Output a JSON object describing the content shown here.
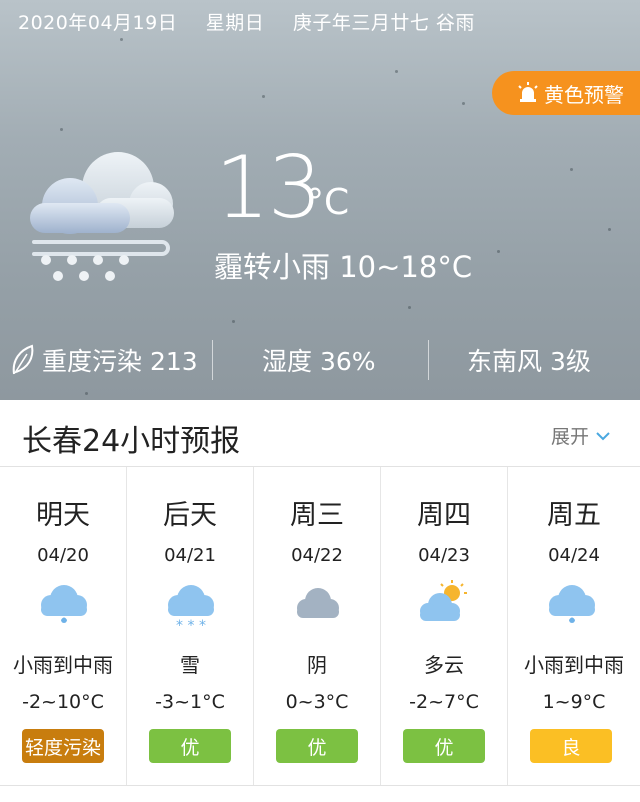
{
  "header": {
    "date": "2020年04月19日",
    "weekday": "星期日",
    "lunar": "庚子年三月廿七 谷雨"
  },
  "alert": {
    "label": "黄色预警",
    "icon": "alarm-light-icon",
    "color": "#f6921e"
  },
  "current": {
    "icon": "cloud-snow-icon",
    "temperature": "13",
    "unit": "°C",
    "condition": "霾转小雨 10~18°C"
  },
  "stats": {
    "air": "重度污染 213",
    "air_icon": "leaf-icon",
    "humidity": "湿度 36%",
    "wind": "东南风 3级"
  },
  "forecast": {
    "title": "长春24小时预报",
    "expand_label": "展开",
    "days": [
      {
        "name": "明天",
        "date": "04/20",
        "icon": "light-rain-icon",
        "condition": "小雨到中雨",
        "temp": "-2~10°C",
        "aqi": "轻度污染",
        "aqi_color": "#c87d0e"
      },
      {
        "name": "后天",
        "date": "04/21",
        "icon": "snow-icon",
        "condition": "雪",
        "temp": "-3~1°C",
        "aqi": "优",
        "aqi_color": "#7cc142"
      },
      {
        "name": "周三",
        "date": "04/22",
        "icon": "overcast-cloud-icon",
        "condition": "阴",
        "temp": "0~3°C",
        "aqi": "优",
        "aqi_color": "#7cc142"
      },
      {
        "name": "周四",
        "date": "04/23",
        "icon": "partly-cloudy-icon",
        "condition": "多云",
        "temp": "-2~7°C",
        "aqi": "优",
        "aqi_color": "#7cc142"
      },
      {
        "name": "周五",
        "date": "04/24",
        "icon": "light-rain-icon",
        "condition": "小雨到中雨",
        "temp": "1~9°C",
        "aqi": "良",
        "aqi_color": "#fbbf24"
      }
    ]
  }
}
